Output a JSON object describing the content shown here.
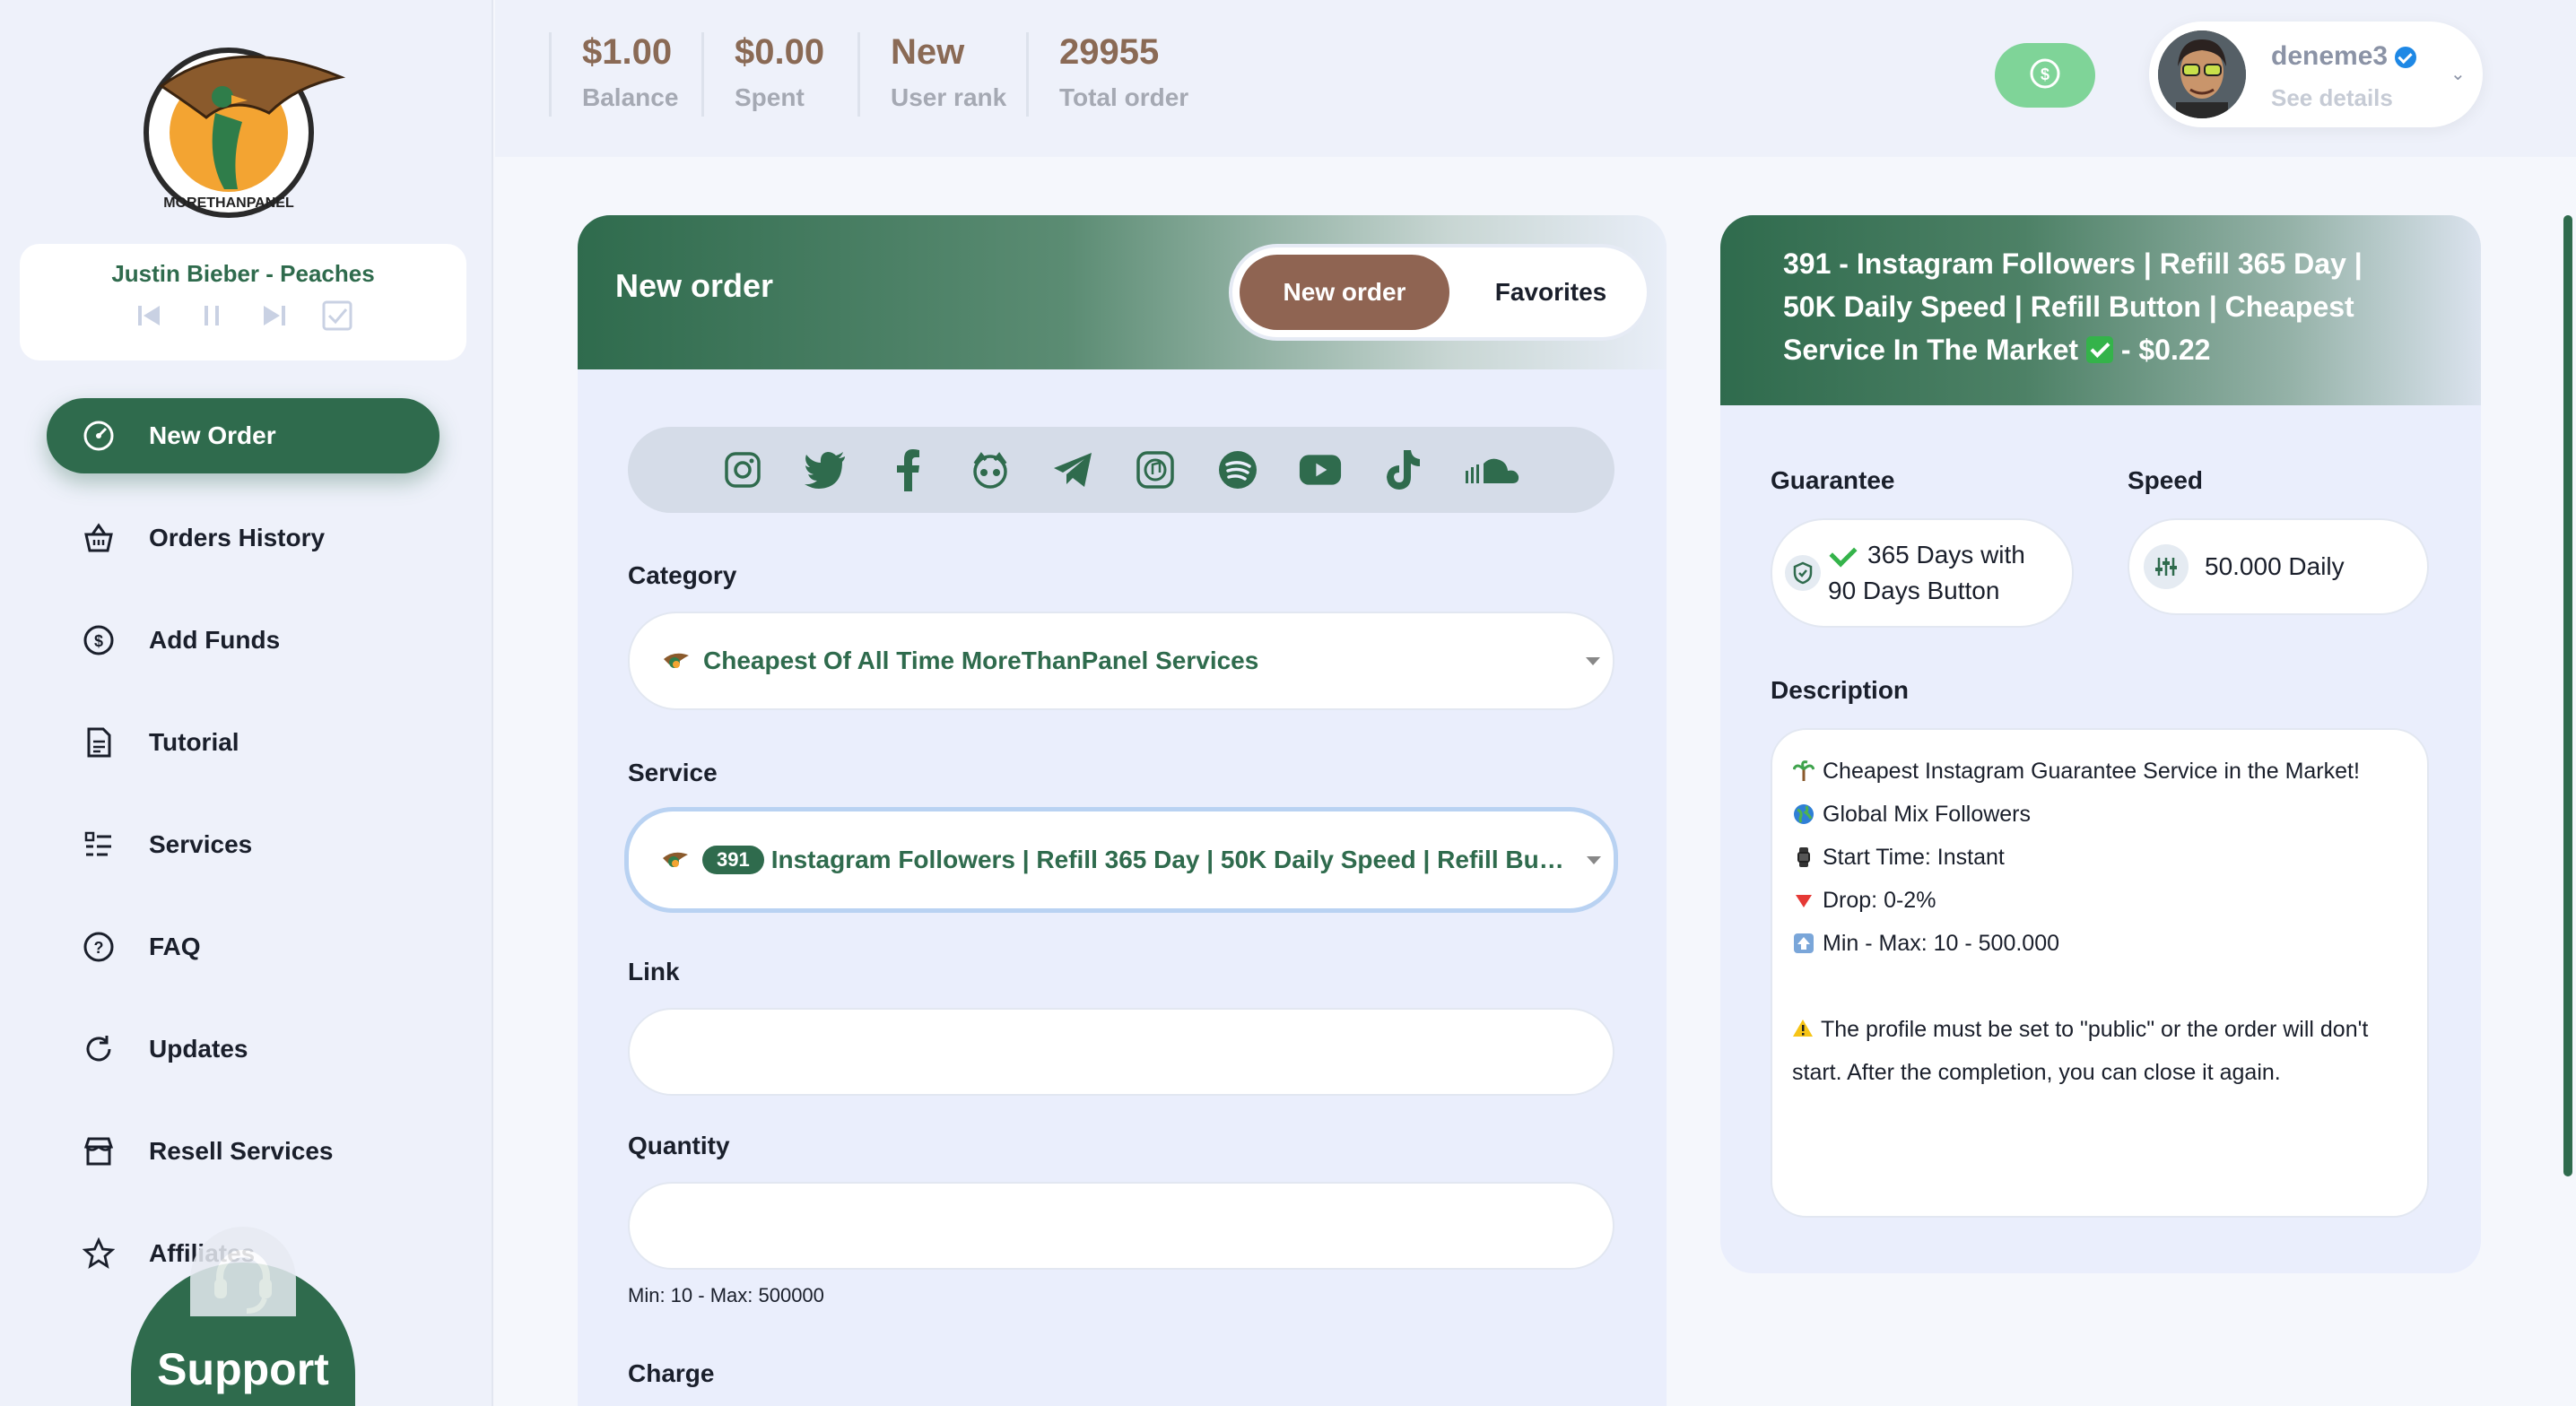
{
  "brand": {
    "logo_text": "MORETHANPANEL"
  },
  "player": {
    "track": "Justin Bieber - Peaches"
  },
  "nav": {
    "items": [
      {
        "label": "New Order",
        "icon": "speedometer-icon"
      },
      {
        "label": "Orders History",
        "icon": "basket-icon"
      },
      {
        "label": "Add Funds",
        "icon": "funds-icon"
      },
      {
        "label": "Tutorial",
        "icon": "document-icon"
      },
      {
        "label": "Services",
        "icon": "list-icon"
      },
      {
        "label": "FAQ",
        "icon": "question-icon"
      },
      {
        "label": "Updates",
        "icon": "refresh-icon"
      },
      {
        "label": "Resell Services",
        "icon": "store-icon"
      },
      {
        "label": "Affiliates",
        "icon": "star-icon"
      }
    ],
    "support_label": "Support"
  },
  "stats": [
    {
      "value": "$1.00",
      "label": "Balance"
    },
    {
      "value": "$0.00",
      "label": "Spent"
    },
    {
      "value": "New",
      "label": "User rank"
    },
    {
      "value": "29955",
      "label": "Total order"
    }
  ],
  "user": {
    "name": "deneme3",
    "details": "See details"
  },
  "order": {
    "title": "New order",
    "tabs": [
      "New order",
      "Favorites"
    ],
    "platforms": [
      "instagram-icon",
      "twitter-icon",
      "facebook-icon",
      "napster-icon",
      "telegram-icon",
      "music-icon",
      "spotify-icon",
      "youtube-icon",
      "tiktok-icon",
      "soundcloud-icon"
    ],
    "category_label": "Category",
    "category_value": "Cheapest Of All Time MoreThanPanel Services",
    "service_label": "Service",
    "service_id": "391",
    "service_value": "Instagram Followers | Refill 365 Day | 50K Daily Speed | Refill Butto...",
    "link_label": "Link",
    "quantity_label": "Quantity",
    "quantity_hint": "Min: 10 - Max: 500000",
    "charge_label": "Charge"
  },
  "detail": {
    "title": "391 - Instagram Followers | Refill 365 Day | 50K Daily Speed | Refill Button | Cheapest Service In The Market",
    "price": " - $0.22",
    "guarantee_label": "Guarantee",
    "guarantee_value": "365 Days with 90 Days Button",
    "speed_label": "Speed",
    "speed_value": "50.000 Daily",
    "description_label": "Description",
    "description": [
      "Cheapest Instagram Guarantee Service in the Market!",
      "Global Mix Followers",
      "Start Time: Instant",
      "Drop: 0-2%",
      "Min - Max: 10 - 500.000"
    ],
    "warning": "The profile must be set to \"public\" or the order will don't start. After the completion, you can close it again."
  },
  "colors": {
    "primary": "#2f6b4d",
    "accent_brown": "#8f6452",
    "money_green": "#7fd498"
  }
}
